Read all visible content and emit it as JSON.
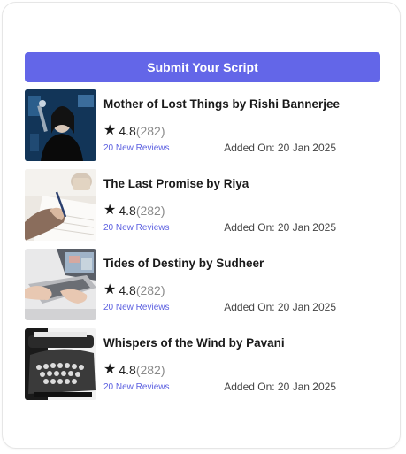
{
  "submit_button": {
    "label": "Submit Your Script"
  },
  "scripts": [
    {
      "title": "Mother of Lost Things by Rishi Bannerjee",
      "rating": "4.8",
      "rating_count": "(282)",
      "reviews": "20 New Reviews",
      "added": "Added On: 20 Jan 2025",
      "thumbnail_icon": "dark-figure-image"
    },
    {
      "title": "The Last Promise by Riya",
      "rating": "4.8",
      "rating_count": "(282)",
      "reviews": "20 New Reviews",
      "added": "Added On: 20 Jan 2025",
      "thumbnail_icon": "writing-hand-image"
    },
    {
      "title": "Tides of Destiny by Sudheer",
      "rating": "4.8",
      "rating_count": "(282)",
      "reviews": "20 New Reviews",
      "added": "Added On: 20 Jan 2025",
      "thumbnail_icon": "laptop-typing-image"
    },
    {
      "title": "Whispers of the Wind by Pavani",
      "rating": "4.8",
      "rating_count": "(282)",
      "reviews": "20 New Reviews",
      "added": "Added On: 20 Jan 2025",
      "thumbnail_icon": "typewriter-image"
    }
  ],
  "colors": {
    "accent": "#6366e8",
    "link": "#5b5fe0"
  }
}
